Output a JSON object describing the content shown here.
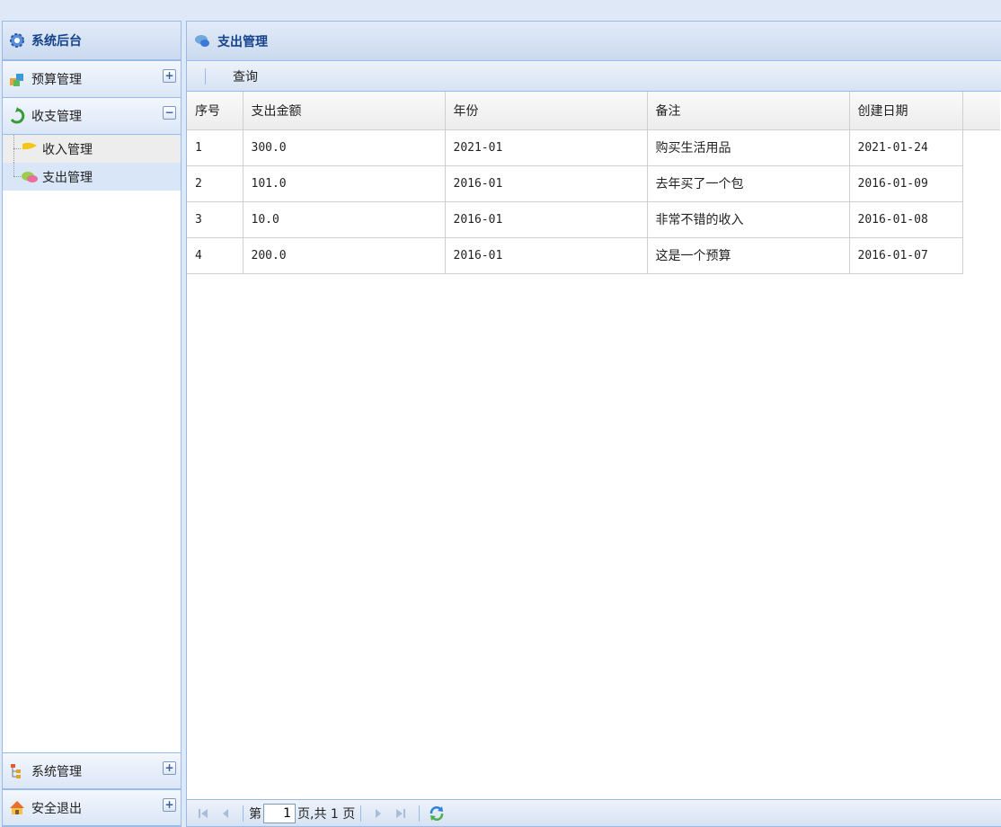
{
  "sidebar": {
    "title": "系统后台",
    "panels": [
      {
        "label": "预算管理",
        "tool": "+"
      },
      {
        "label": "收支管理",
        "tool": "−"
      }
    ],
    "tree": [
      {
        "label": "收入管理"
      },
      {
        "label": "支出管理"
      }
    ],
    "bottom_panels": [
      {
        "label": "系统管理",
        "tool": "+"
      },
      {
        "label": "安全退出",
        "tool": "+"
      }
    ]
  },
  "main": {
    "title": "支出管理",
    "toolbar": {
      "query_label": "查询"
    },
    "columns": [
      "序号",
      "支出金额",
      "年份",
      "备注",
      "创建日期"
    ],
    "rows": [
      [
        "1",
        "300.0",
        "2021-01",
        "购买生活用品",
        "2021-01-24"
      ],
      [
        "2",
        "101.0",
        "2016-01",
        "去年买了一个包",
        "2016-01-09"
      ],
      [
        "3",
        "10.0",
        "2016-01",
        "非常不错的收入",
        "2016-01-08"
      ],
      [
        "4",
        "200.0",
        "2016-01",
        "这是一个预算",
        "2016-01-07"
      ]
    ]
  },
  "pager": {
    "page_prefix": "第",
    "page_value": "1",
    "page_suffix": "页,共 1 页"
  }
}
